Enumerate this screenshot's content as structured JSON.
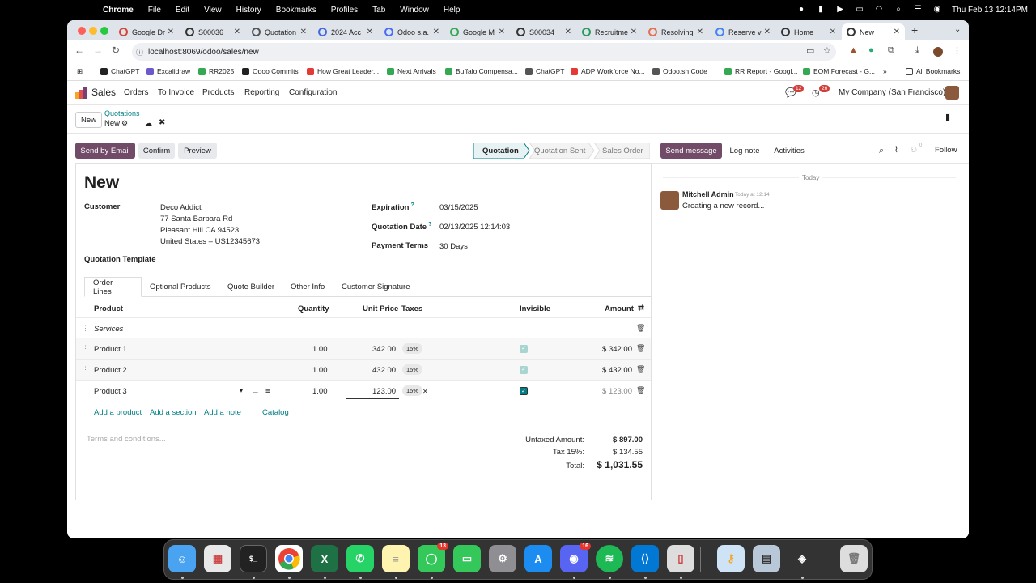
{
  "menubar": {
    "app": "Chrome",
    "items": [
      "File",
      "Edit",
      "View",
      "History",
      "Bookmarks",
      "Profiles",
      "Tab",
      "Window",
      "Help"
    ],
    "clock": "Thu Feb 13  12:14PM"
  },
  "browser": {
    "tabs": [
      {
        "title": "Google Dr"
      },
      {
        "title": "S00036"
      },
      {
        "title": "Quotation"
      },
      {
        "title": "2024 Acc"
      },
      {
        "title": "Odoo s.a."
      },
      {
        "title": "Google M"
      },
      {
        "title": "S00034"
      },
      {
        "title": "Recruitme"
      },
      {
        "title": "Resolving"
      },
      {
        "title": "Reserve v"
      },
      {
        "title": "Home"
      },
      {
        "title": "New"
      }
    ],
    "url": "localhost:8069/odoo/sales/new",
    "bookmarks": [
      "ChatGPT",
      "Excalidraw",
      "RR2025",
      "Odoo Commits",
      "How Great Leader...",
      "Next Arrivals",
      "Buffalo Compensa...",
      "ChatGPT",
      "ADP Workforce No...",
      "Odoo.sh Code",
      "RR Report - Googl...",
      "EOM Forecast - G..."
    ],
    "all_bookmarks": "All Bookmarks"
  },
  "odoo_nav": {
    "app_name": "Sales",
    "menu": [
      "Orders",
      "To Invoice",
      "Products",
      "Reporting",
      "Configuration"
    ],
    "messages_badge": "12",
    "activities_badge": "26",
    "company": "My Company (San Francisco)"
  },
  "control": {
    "new_button": "New",
    "breadcrumb_parent": "Quotations",
    "breadcrumb_current": "New"
  },
  "actions": {
    "send_email": "Send by Email",
    "confirm": "Confirm",
    "preview": "Preview",
    "stages": [
      "Quotation",
      "Quotation Sent",
      "Sales Order"
    ]
  },
  "form": {
    "title": "New",
    "customer_label": "Customer",
    "customer_name": "Deco Addict",
    "address1": "77 Santa Barbara Rd",
    "address2": "Pleasant Hill CA 94523",
    "address3": "United States – US12345673",
    "expiration_label": "Expiration",
    "expiration": "03/15/2025",
    "quotation_date_label": "Quotation Date",
    "quotation_date": "02/13/2025 12:14:03",
    "payment_terms_label": "Payment Terms",
    "payment_terms": "30 Days",
    "template_label": "Quotation Template",
    "tabs": [
      "Order Lines",
      "Optional Products",
      "Quote Builder",
      "Other Info",
      "Customer Signature"
    ],
    "columns": {
      "product": "Product",
      "quantity": "Quantity",
      "unit_price": "Unit Price",
      "taxes": "Taxes",
      "invisible": "Invisible",
      "amount": "Amount"
    },
    "section": "Services",
    "lines": [
      {
        "product": "Product 1",
        "qty": "1.00",
        "price": "342.00",
        "tax": "15%",
        "amount": "$ 342.00"
      },
      {
        "product": "Product 2",
        "qty": "1.00",
        "price": "432.00",
        "tax": "15%",
        "amount": "$ 432.00"
      },
      {
        "product": "Product 3",
        "qty": "1.00",
        "price": "123.00",
        "tax": "15%",
        "amount": "$ 123.00"
      }
    ],
    "add_links": [
      "Add a product",
      "Add a section",
      "Add a note",
      "Catalog"
    ],
    "terms_placeholder": "Terms and conditions...",
    "untaxed_label": "Untaxed Amount:",
    "untaxed": "$ 897.00",
    "tax_label": "Tax 15%:",
    "tax": "$ 134.55",
    "total_label": "Total:",
    "total": "$ 1,031.55"
  },
  "chatter": {
    "send_message": "Send message",
    "log_note": "Log note",
    "activities": "Activities",
    "follow": "Follow",
    "followers_count": "0",
    "date_divider": "Today",
    "author": "Mitchell Admin",
    "time": "Today at 12:14",
    "message": "Creating a new record..."
  },
  "dock": {
    "messages_badge": "13",
    "discord_badge": "16"
  },
  "colors": {
    "primary": "#714b67",
    "teal": "#017e84"
  }
}
